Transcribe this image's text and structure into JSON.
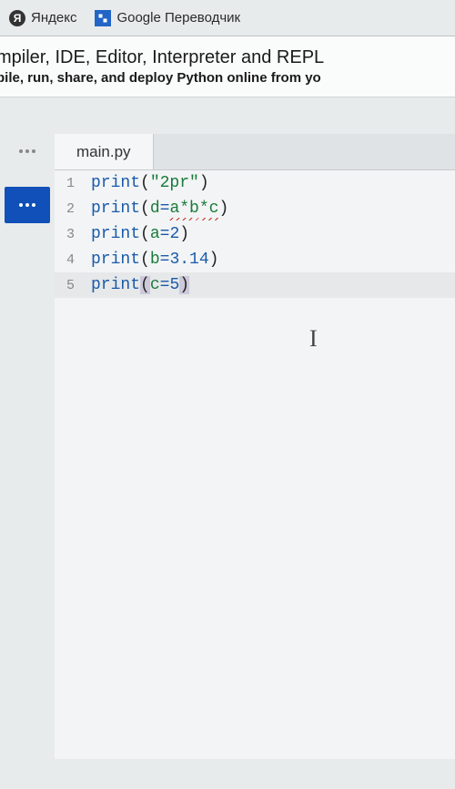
{
  "bookmarks": [
    {
      "label": "Яндекс"
    },
    {
      "label": "Google Переводчик"
    }
  ],
  "header": {
    "title": "mpiler, IDE, Editor, Interpreter and REPL",
    "subtitle": "pile, run, share, and deploy Python online from yo"
  },
  "editor": {
    "tab_name": "main.py",
    "lines": [
      {
        "num": "1",
        "tokens": [
          {
            "t": "print",
            "c": "func"
          },
          {
            "t": "(",
            "c": "paren"
          },
          {
            "t": "\"2pr\"",
            "c": "str"
          },
          {
            "t": ")",
            "c": "paren"
          }
        ]
      },
      {
        "num": "2",
        "tokens": [
          {
            "t": "print",
            "c": "func"
          },
          {
            "t": "(",
            "c": "paren"
          },
          {
            "t": "d",
            "c": "var"
          },
          {
            "t": "=",
            "c": "op"
          },
          {
            "t": "a*b*c",
            "c": "var",
            "squiggle": true
          },
          {
            "t": ")",
            "c": "paren"
          }
        ]
      },
      {
        "num": "3",
        "tokens": [
          {
            "t": "print",
            "c": "func"
          },
          {
            "t": "(",
            "c": "paren"
          },
          {
            "t": "a",
            "c": "var"
          },
          {
            "t": "=",
            "c": "op"
          },
          {
            "t": "2",
            "c": "num"
          },
          {
            "t": ")",
            "c": "paren"
          }
        ]
      },
      {
        "num": "4",
        "tokens": [
          {
            "t": "print",
            "c": "func"
          },
          {
            "t": "(",
            "c": "paren"
          },
          {
            "t": "b",
            "c": "var"
          },
          {
            "t": "=",
            "c": "op"
          },
          {
            "t": "3.14",
            "c": "num"
          },
          {
            "t": ")",
            "c": "paren"
          }
        ]
      },
      {
        "num": "5",
        "highlighted": true,
        "tokens": [
          {
            "t": "print",
            "c": "func"
          },
          {
            "t": "(",
            "c": "paren",
            "hl": true
          },
          {
            "t": "c",
            "c": "var"
          },
          {
            "t": "=",
            "c": "op"
          },
          {
            "t": "5",
            "c": "num"
          },
          {
            "t": ")",
            "c": "paren",
            "hl": true
          }
        ]
      }
    ]
  }
}
